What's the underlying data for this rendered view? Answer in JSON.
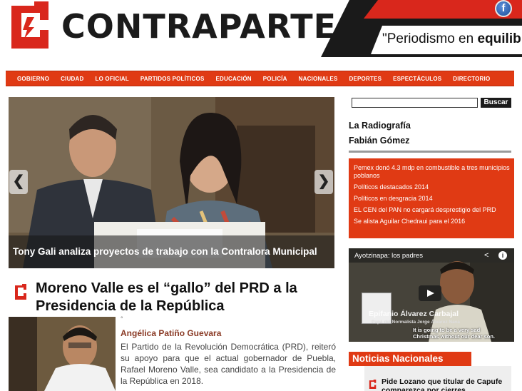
{
  "header": {
    "brand": "CONTRAPARTE",
    "slogan_prefix": "\"Periodismo en ",
    "slogan_bold": "equilibrio",
    "logo_icon": "contraparte-logo-mark",
    "social_icon": "facebook-icon",
    "social_glyph": "f"
  },
  "nav": {
    "items": [
      "GOBIERNO",
      "CIUDAD",
      "LO OFICIAL",
      "PARTIDOS POLÍTICOS",
      "EDUCACIÓN",
      "POLICÍA",
      "NACIONALES",
      "DEPORTES",
      "ESPECTÁCULOS",
      "DIRECTORIO"
    ]
  },
  "slider": {
    "caption": "Tony Gali analiza proyectos de trabajo con la Contralora Municipal",
    "prev_glyph": "❮",
    "next_glyph": "❯"
  },
  "article": {
    "title": "Moreno Valle es el “gallo” del PRD a la Presidencia de la República",
    "dot": "°",
    "author": "Angélica Patiño Guevara",
    "body": "El Partido de la Revolución Democrática (PRD), reiteró su apoyo para que el actual gobernador de Puebla, Rafael Moreno Valle, sea candidato a la Presidencia de la República en 2018."
  },
  "sidebar": {
    "search_placeholder": "",
    "search_button": "Buscar",
    "column_title_1": "La Radiografía",
    "column_title_2": "Fabián Gómez",
    "red_links": [
      "Pemex donó 4.3 mdp en combustible a tres municipios poblanos",
      "Políticos destacados 2014",
      "Políticos en desgracia 2014",
      "EL CEN del PAN no cargará desprestigio del PRD",
      "Se alista Aguilar Chedraui para el 2016"
    ],
    "video": {
      "title": "Ayotzinapa: los padres",
      "share_glyph": "<",
      "info_glyph": "i",
      "name": "Epifanio Álvarez Carbajal",
      "sub": "Papá del Normalista Jorge Álvarez Nava",
      "caption_1": "It is going to be a very sad",
      "caption_2": "Christmas without our dear son."
    },
    "noticias_title": "Noticias Nacionales",
    "noticias_item": "Pide Lozano que titular de Capufe comparezca por cierres"
  },
  "colors": {
    "accent": "#e03a14",
    "dark": "#1b1b1b"
  }
}
